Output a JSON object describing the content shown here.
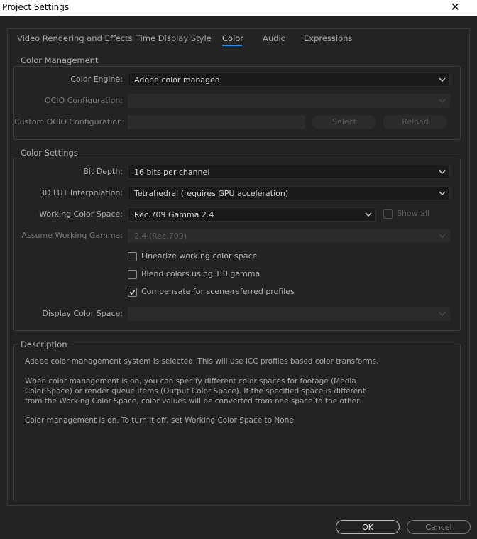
{
  "window": {
    "title": "Project Settings",
    "close_glyph": "✕"
  },
  "tabs": [
    {
      "label": "Video Rendering and Effects"
    },
    {
      "label": "Time Display Style"
    },
    {
      "label": "Color",
      "active": true
    },
    {
      "label": "Audio"
    },
    {
      "label": "Expressions"
    }
  ],
  "color_management": {
    "title": "Color Management",
    "color_engine": {
      "label": "Color Engine:",
      "value": "Adobe color managed"
    },
    "ocio_configuration": {
      "label": "OCIO Configuration:",
      "value": ""
    },
    "custom_ocio": {
      "label": "Custom OCIO Configuration:",
      "select_label": "Select",
      "reload_label": "Reload"
    }
  },
  "color_settings": {
    "title": "Color Settings",
    "bit_depth": {
      "label": "Bit Depth:",
      "value": "16 bits per channel"
    },
    "lut_interpolation": {
      "label": "3D LUT Interpolation:",
      "value": "Tetrahedral (requires GPU acceleration)"
    },
    "working_color_space": {
      "label": "Working Color Space:",
      "value": "Rec.709 Gamma 2.4",
      "show_all_label": "Show all",
      "show_all_checked": false
    },
    "assume_working_gamma": {
      "label": "Assume Working Gamma:",
      "value": "2.4 (Rec.709)"
    },
    "checkboxes": [
      {
        "label": "Linearize working color space",
        "checked": false
      },
      {
        "label": "Blend colors using 1.0 gamma",
        "checked": false
      },
      {
        "label": "Compensate for scene-referred profiles",
        "checked": true
      }
    ],
    "display_color_space": {
      "label": "Display Color Space:",
      "value": ""
    }
  },
  "description": {
    "title": "Description",
    "paragraphs": [
      "Adobe color management system is selected. This will use ICC profiles based color transforms.",
      "When color management is on, you can specify different color spaces for footage (Media Color Space) or render queue items (Output Color Space). If the specified space is different from the Working Color Space, color values will be converted from one space to the other.",
      "Color management is on. To turn it off, set Working Color Space to None."
    ]
  },
  "buttons": {
    "ok": "OK",
    "cancel": "Cancel"
  },
  "colors": {
    "accent": "#2d8ceb",
    "background": "#232323",
    "input_bg": "#1a1a1a"
  },
  "icons": {
    "dropdown": "chevron-down-icon",
    "check": "checkmark-icon"
  }
}
